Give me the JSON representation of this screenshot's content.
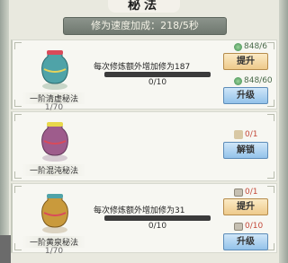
{
  "title": "秘法",
  "speed_text": "修为速度加成：218/5秒",
  "techniques": [
    {
      "name": "一阶清虚秘法",
      "level": "1/70",
      "icon": "jade-vase-icon",
      "accent": "#4fa3a8",
      "description": "每次修炼额外增加修为187",
      "progress": "0/10",
      "progress_fraction": 0,
      "costs": [
        {
          "icon": "spirit-stone-icon",
          "text": "848/6",
          "ok": true
        },
        {
          "icon": "spirit-stone-icon",
          "text": "848/60",
          "ok": true
        }
      ],
      "buttons": [
        {
          "label": "提升",
          "style": "gold"
        },
        {
          "label": "升级",
          "style": "blue"
        }
      ]
    },
    {
      "name": "一阶混沌秘法",
      "level": "",
      "icon": "purple-vase-icon",
      "accent": "#9e5c8c",
      "description": "",
      "progress": "",
      "costs": [
        {
          "icon": "unlock-token-icon",
          "text": "0/1",
          "ok": false
        }
      ],
      "buttons": [
        {
          "label": "解锁",
          "style": "blue"
        }
      ]
    },
    {
      "name": "一阶黄泉秘法",
      "level": "1/70",
      "icon": "gold-vase-icon",
      "accent": "#c99a3c",
      "description": "每次修炼额外增加修为31",
      "progress": "0/10",
      "progress_fraction": 0,
      "costs": [
        {
          "icon": "scroll-icon",
          "text": "0/1",
          "ok": false
        },
        {
          "icon": "scroll-icon",
          "text": "0/10",
          "ok": false
        }
      ],
      "buttons": [
        {
          "label": "提升",
          "style": "gold"
        },
        {
          "label": "升级",
          "style": "blue"
        }
      ]
    }
  ]
}
